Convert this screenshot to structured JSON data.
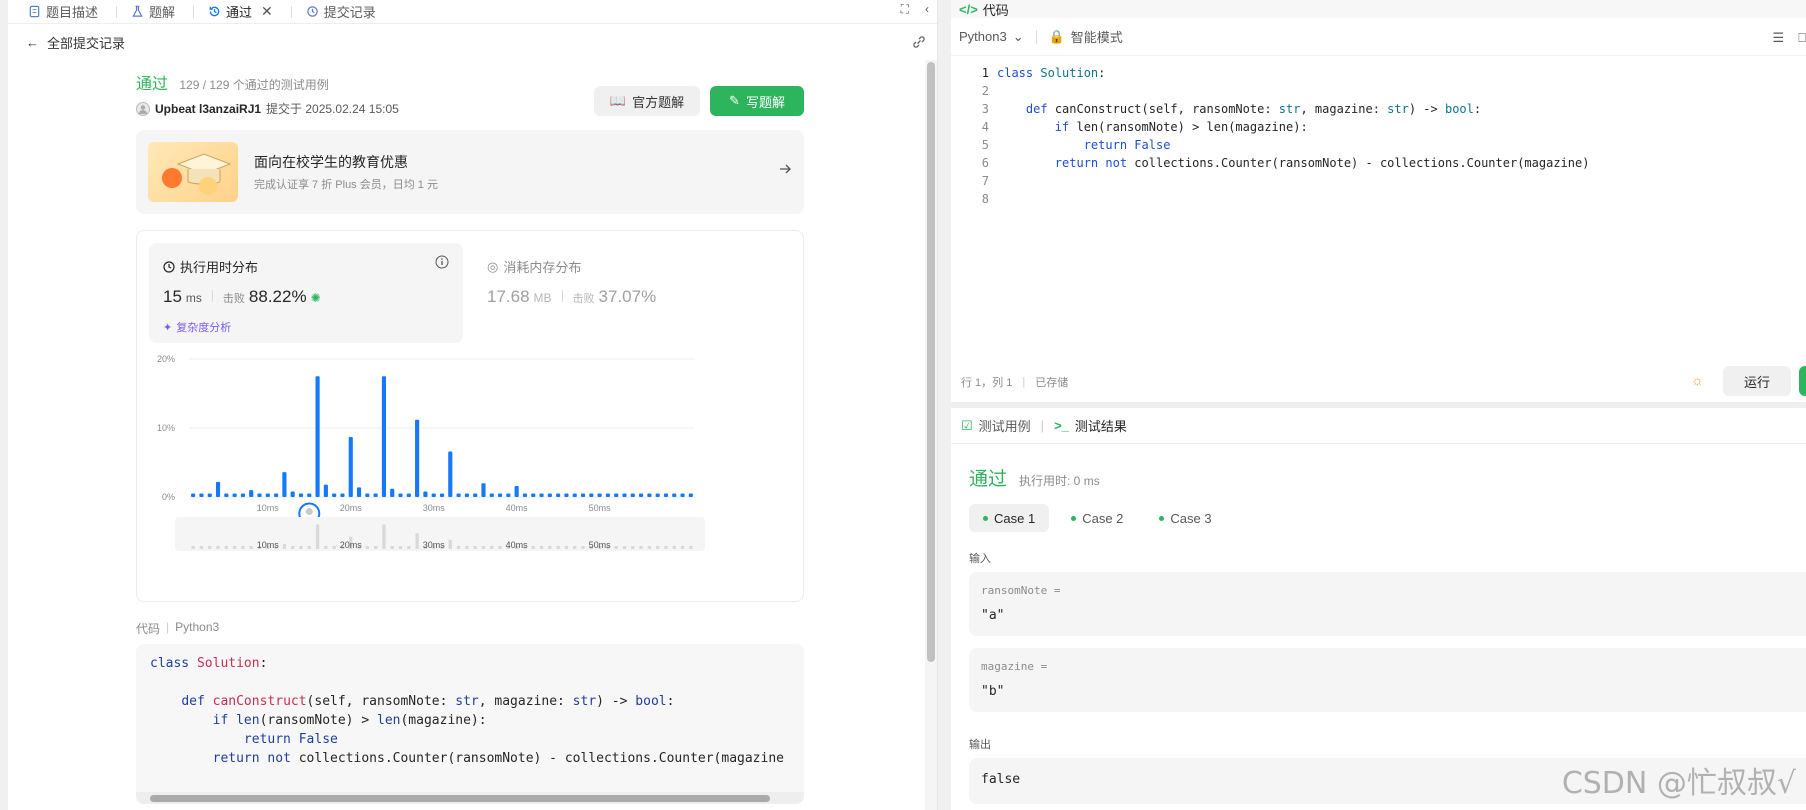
{
  "left_tabs": [
    {
      "label": "题目描述",
      "icon": "document-icon"
    },
    {
      "label": "题解",
      "icon": "flask-icon"
    },
    {
      "label": "通过",
      "icon": "history-icon",
      "active": true
    },
    {
      "label": "提交记录",
      "icon": "clock-icon"
    }
  ],
  "sub_header": {
    "back_label": "全部提交记录"
  },
  "submission": {
    "status": "通过",
    "cases": "129 / 129 个通过的测试用例",
    "author": "Upbeat l3anzaiRJ1",
    "submitted_at": "提交于 2025.02.24 15:05",
    "official_solution_label": "官方题解",
    "write_solution_label": "写题解"
  },
  "promo": {
    "title": "面向在校学生的教育优惠",
    "desc": "完成认证享 7 折 Plus 会员，日均 1 元"
  },
  "runtime": {
    "title": "执行用时分布",
    "value": "15",
    "unit": "ms",
    "beat_label": "击败",
    "beat_value": "88.22%",
    "complexity_label": "复杂度分析"
  },
  "memory": {
    "title": "消耗内存分布",
    "value": "17.68",
    "unit": "MB",
    "beat_label": "击败",
    "beat_value": "37.07%"
  },
  "chart_data": {
    "type": "bar",
    "ylim": [
      0,
      20
    ],
    "yticks": [
      "0%",
      "10%",
      "20%"
    ],
    "xticks": [
      "10ms",
      "20ms",
      "30ms",
      "40ms",
      "50ms"
    ],
    "x_start_ms": 1,
    "x_step_ms": 1,
    "values": [
      0.5,
      0.5,
      0.5,
      2.2,
      0.5,
      0.5,
      0.5,
      1.0,
      0.5,
      0.5,
      0.5,
      3.6,
      0.8,
      0.5,
      0.5,
      17.5,
      1.8,
      0.5,
      0.5,
      8.7,
      1.4,
      0.5,
      0.5,
      17.5,
      1.2,
      0.5,
      0.5,
      11.2,
      0.8,
      0.5,
      0.5,
      6.6,
      0.5,
      0.5,
      0.5,
      2.0,
      0.5,
      0.5,
      0.5,
      1.6,
      0.5,
      0.5,
      0.5,
      0.5,
      0.5,
      0.5,
      0.5,
      0.5,
      0.5,
      0.5,
      0.5,
      0.5,
      0.5,
      0.5,
      0.5,
      0.5,
      0.5,
      0.5,
      0.5,
      0.5,
      0.5
    ],
    "highlight_index": 14,
    "grid": true
  },
  "left_code": {
    "label": "代码",
    "language": "Python3",
    "lines": [
      "class Solution:",
      "",
      "    def canConstruct(self, ransomNote: str, magazine: str) -> bool:",
      "        if len(ransomNote) > len(magazine):",
      "            return False",
      "        return not collections.Counter(ransomNote) - collections.Counter(magazine"
    ]
  },
  "editor": {
    "title": "代码",
    "language": "Python3",
    "mode": "智能模式",
    "lines": [
      "class Solution:",
      "",
      "    def canConstruct(self, ransomNote: str, magazine: str) -> bool:",
      "        if len(ransomNote) > len(magazine):",
      "            return False",
      "        return not collections.Counter(ransomNote) - collections.Counter(magazine)",
      "",
      ""
    ],
    "cursor": "行 1，列 1",
    "saved": "已存储",
    "run_label": "运行"
  },
  "results": {
    "tab_cases": "测试用例",
    "tab_results": "测试结果",
    "status": "通过",
    "time": "执行用时: 0 ms",
    "cases": [
      "Case 1",
      "Case 2",
      "Case 3"
    ],
    "input_label": "输入",
    "param1_name": "ransomNote =",
    "param1_value": "\"a\"",
    "param2_name": "magazine =",
    "param2_value": "\"b\"",
    "output_label": "输出",
    "output_value": "false"
  },
  "watermark": "CSDN @忙叔叔√",
  "colors": {
    "accent_green": "#2db55d",
    "bar_blue": "#1677ff",
    "complexity_purple": "#7a5af8"
  }
}
